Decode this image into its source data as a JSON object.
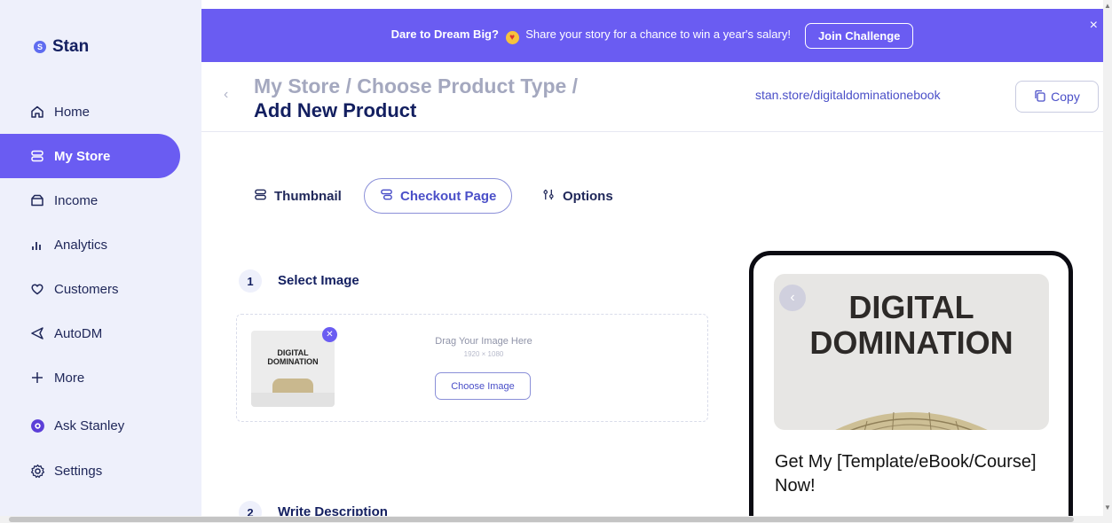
{
  "sidebar": {
    "logo_mark": "S",
    "logo_text": "Stan",
    "items": [
      {
        "label": "Home",
        "icon": "home-icon"
      },
      {
        "label": "My Store",
        "icon": "store-icon"
      },
      {
        "label": "Income",
        "icon": "wallet-icon"
      },
      {
        "label": "Analytics",
        "icon": "bar-chart-icon"
      },
      {
        "label": "Customers",
        "icon": "heart-icon"
      },
      {
        "label": "AutoDM",
        "icon": "send-icon"
      },
      {
        "label": "More",
        "icon": "plus-icon"
      },
      {
        "label": "Ask Stanley",
        "icon": "stanley-icon"
      },
      {
        "label": "Settings",
        "icon": "gear-icon"
      }
    ],
    "active": "My Store"
  },
  "banner": {
    "bold_text": "Dare to Dream Big?",
    "text": "Share your story for a chance to win a year's salary!",
    "button_label": "Join Challenge",
    "close": "×"
  },
  "header": {
    "breadcrumb": "My Store / Choose Product Type /",
    "title": "Add New Product",
    "store_url": "stan.store/digitaldominationebook",
    "copy_label": "Copy"
  },
  "tabs": [
    {
      "label": "Thumbnail",
      "icon": "thumbnail-icon"
    },
    {
      "label": "Checkout Page",
      "icon": "checkout-icon"
    },
    {
      "label": "Options",
      "icon": "options-icon"
    }
  ],
  "active_tab": "Checkout Page",
  "steps": [
    {
      "number": "1",
      "label": "Select Image"
    },
    {
      "number": "2",
      "label": "Write Description"
    }
  ],
  "dropzone": {
    "thumbnail_text": "DIGITAL DOMINATION",
    "drag_text": "Drag Your Image Here",
    "dimensions": "1920 × 1080",
    "button_label": "Choose Image"
  },
  "preview": {
    "cover_title_line1": "DIGITAL",
    "cover_title_line2": "DOMINATION",
    "product_title": "Get My [Template/eBook/Course] Now!"
  },
  "colors": {
    "accent": "#6a5cf2",
    "sidebar_bg": "#eef0fb",
    "navy": "#131f60",
    "link": "#4a4fc8"
  }
}
